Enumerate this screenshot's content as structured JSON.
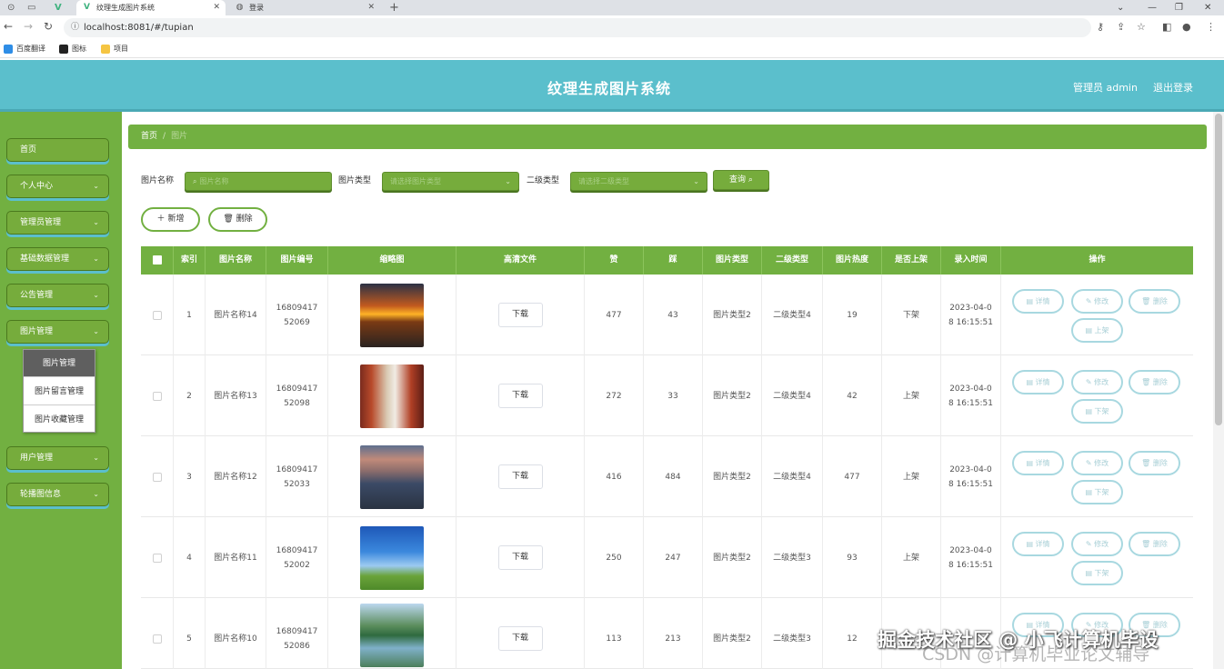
{
  "browser": {
    "tabs": [
      {
        "title": "",
        "active": false
      },
      {
        "title": "纹理生成图片系统",
        "active": true
      },
      {
        "title": "登录",
        "active": false
      }
    ],
    "new_tab": "+",
    "url": "localhost:8081/#/tupian",
    "bookmarks": [
      "百度翻译",
      "图标",
      "项目"
    ]
  },
  "header": {
    "title": "纹理生成图片系统",
    "user": "管理员 admin",
    "logout": "退出登录"
  },
  "sidebar": {
    "items": [
      {
        "label": "首页",
        "has_arrow": false
      },
      {
        "label": "个人中心",
        "has_arrow": true
      },
      {
        "label": "管理员管理",
        "has_arrow": true
      },
      {
        "label": "基础数据管理",
        "has_arrow": true
      },
      {
        "label": "公告管理",
        "has_arrow": true
      },
      {
        "label": "图片管理",
        "has_arrow": true
      },
      {
        "label": "用户管理",
        "has_arrow": true
      },
      {
        "label": "轮播图信息",
        "has_arrow": true
      }
    ],
    "submenu": [
      "图片管理",
      "图片留言管理",
      "图片收藏管理"
    ]
  },
  "breadcrumb": {
    "home": "首页",
    "separator": "/",
    "current": "图片"
  },
  "filters": {
    "name_label": "图片名称",
    "name_placeholder": "图片名称",
    "type_label": "图片类型",
    "type_placeholder": "请选择图片类型",
    "subtype_label": "二级类型",
    "subtype_placeholder": "请选择二级类型",
    "query_button": "查询"
  },
  "actions": {
    "add": "新增",
    "delete": "删除"
  },
  "table": {
    "headers": [
      "",
      "索引",
      "图片名称",
      "图片编号",
      "缩略图",
      "高清文件",
      "赞",
      "踩",
      "图片类型",
      "二级类型",
      "图片热度",
      "是否上架",
      "录入时间",
      "操作"
    ],
    "download_label": "下载",
    "op_detail": "详情",
    "op_edit": "修改",
    "op_delete": "删除",
    "rows": [
      {
        "index": "1",
        "name": "图片名称14",
        "code_a": "16809417",
        "code_b": "52069",
        "like": "477",
        "dislike": "43",
        "type": "图片类型2",
        "subtype": "二级类型4",
        "heat": "19",
        "status": "下架",
        "time_a": "2023-04-0",
        "time_b": "8 16:15:51",
        "toggle": "上架",
        "thumb": "sunset-road"
      },
      {
        "index": "2",
        "name": "图片名称13",
        "code_a": "16809417",
        "code_b": "52098",
        "like": "272",
        "dislike": "33",
        "type": "图片类型2",
        "subtype": "二级类型4",
        "heat": "42",
        "status": "上架",
        "time_a": "2023-04-0",
        "time_b": "8 16:15:51",
        "toggle": "下架",
        "thumb": "corridor"
      },
      {
        "index": "3",
        "name": "图片名称12",
        "code_a": "16809417",
        "code_b": "52033",
        "like": "416",
        "dislike": "484",
        "type": "图片类型2",
        "subtype": "二级类型4",
        "heat": "477",
        "status": "上架",
        "time_a": "2023-04-0",
        "time_b": "8 16:15:51",
        "toggle": "下架",
        "thumb": "city-mountain"
      },
      {
        "index": "4",
        "name": "图片名称11",
        "code_a": "16809417",
        "code_b": "52002",
        "like": "250",
        "dislike": "247",
        "type": "图片类型2",
        "subtype": "二级类型3",
        "heat": "93",
        "status": "上架",
        "time_a": "2023-04-0",
        "time_b": "8 16:15:51",
        "toggle": "下架",
        "thumb": "sky-field"
      },
      {
        "index": "5",
        "name": "图片名称10",
        "code_a": "16809417",
        "code_b": "52086",
        "like": "113",
        "dislike": "213",
        "type": "图片类型2",
        "subtype": "二级类型3",
        "heat": "12",
        "status": "",
        "time_a": "",
        "time_b": "",
        "toggle": "",
        "thumb": "lake-hills"
      }
    ]
  },
  "watermark": "掘金技术社区 @ 小飞计算机毕设",
  "watermark2": "CSDN @计算机毕业论文辅导",
  "colors": {
    "header": "#5bbfcc",
    "sidebar": "#72b041",
    "accent": "#76ac3c",
    "op_border": "#a8d8e0"
  }
}
